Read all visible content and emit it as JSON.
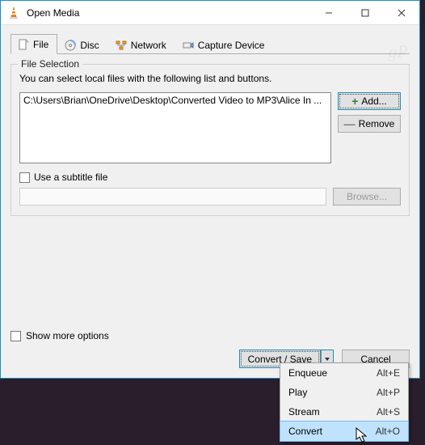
{
  "window": {
    "title": "Open Media"
  },
  "tabs": [
    {
      "label": "File",
      "icon": "file-icon"
    },
    {
      "label": "Disc",
      "icon": "disc-icon"
    },
    {
      "label": "Network",
      "icon": "network-icon"
    },
    {
      "label": "Capture Device",
      "icon": "capture-icon"
    }
  ],
  "file_section": {
    "legend": "File Selection",
    "hint": "You can select local files with the following list and buttons.",
    "selected_path": "C:\\Users\\Brian\\OneDrive\\Desktop\\Converted Video to MP3\\Alice In ...",
    "add_label": "Add...",
    "remove_label": "Remove"
  },
  "subtitle": {
    "checkbox_label": "Use a subtitle file",
    "browse_label": "Browse..."
  },
  "show_more_label": "Show more options",
  "buttons": {
    "convert_save": "Convert / Save",
    "cancel": "Cancel"
  },
  "dropdown": [
    {
      "label": "Enqueue",
      "shortcut": "Alt+E"
    },
    {
      "label": "Play",
      "shortcut": "Alt+P"
    },
    {
      "label": "Stream",
      "shortcut": "Alt+S"
    },
    {
      "label": "Convert",
      "shortcut": "Alt+O"
    }
  ],
  "watermark": "gP"
}
